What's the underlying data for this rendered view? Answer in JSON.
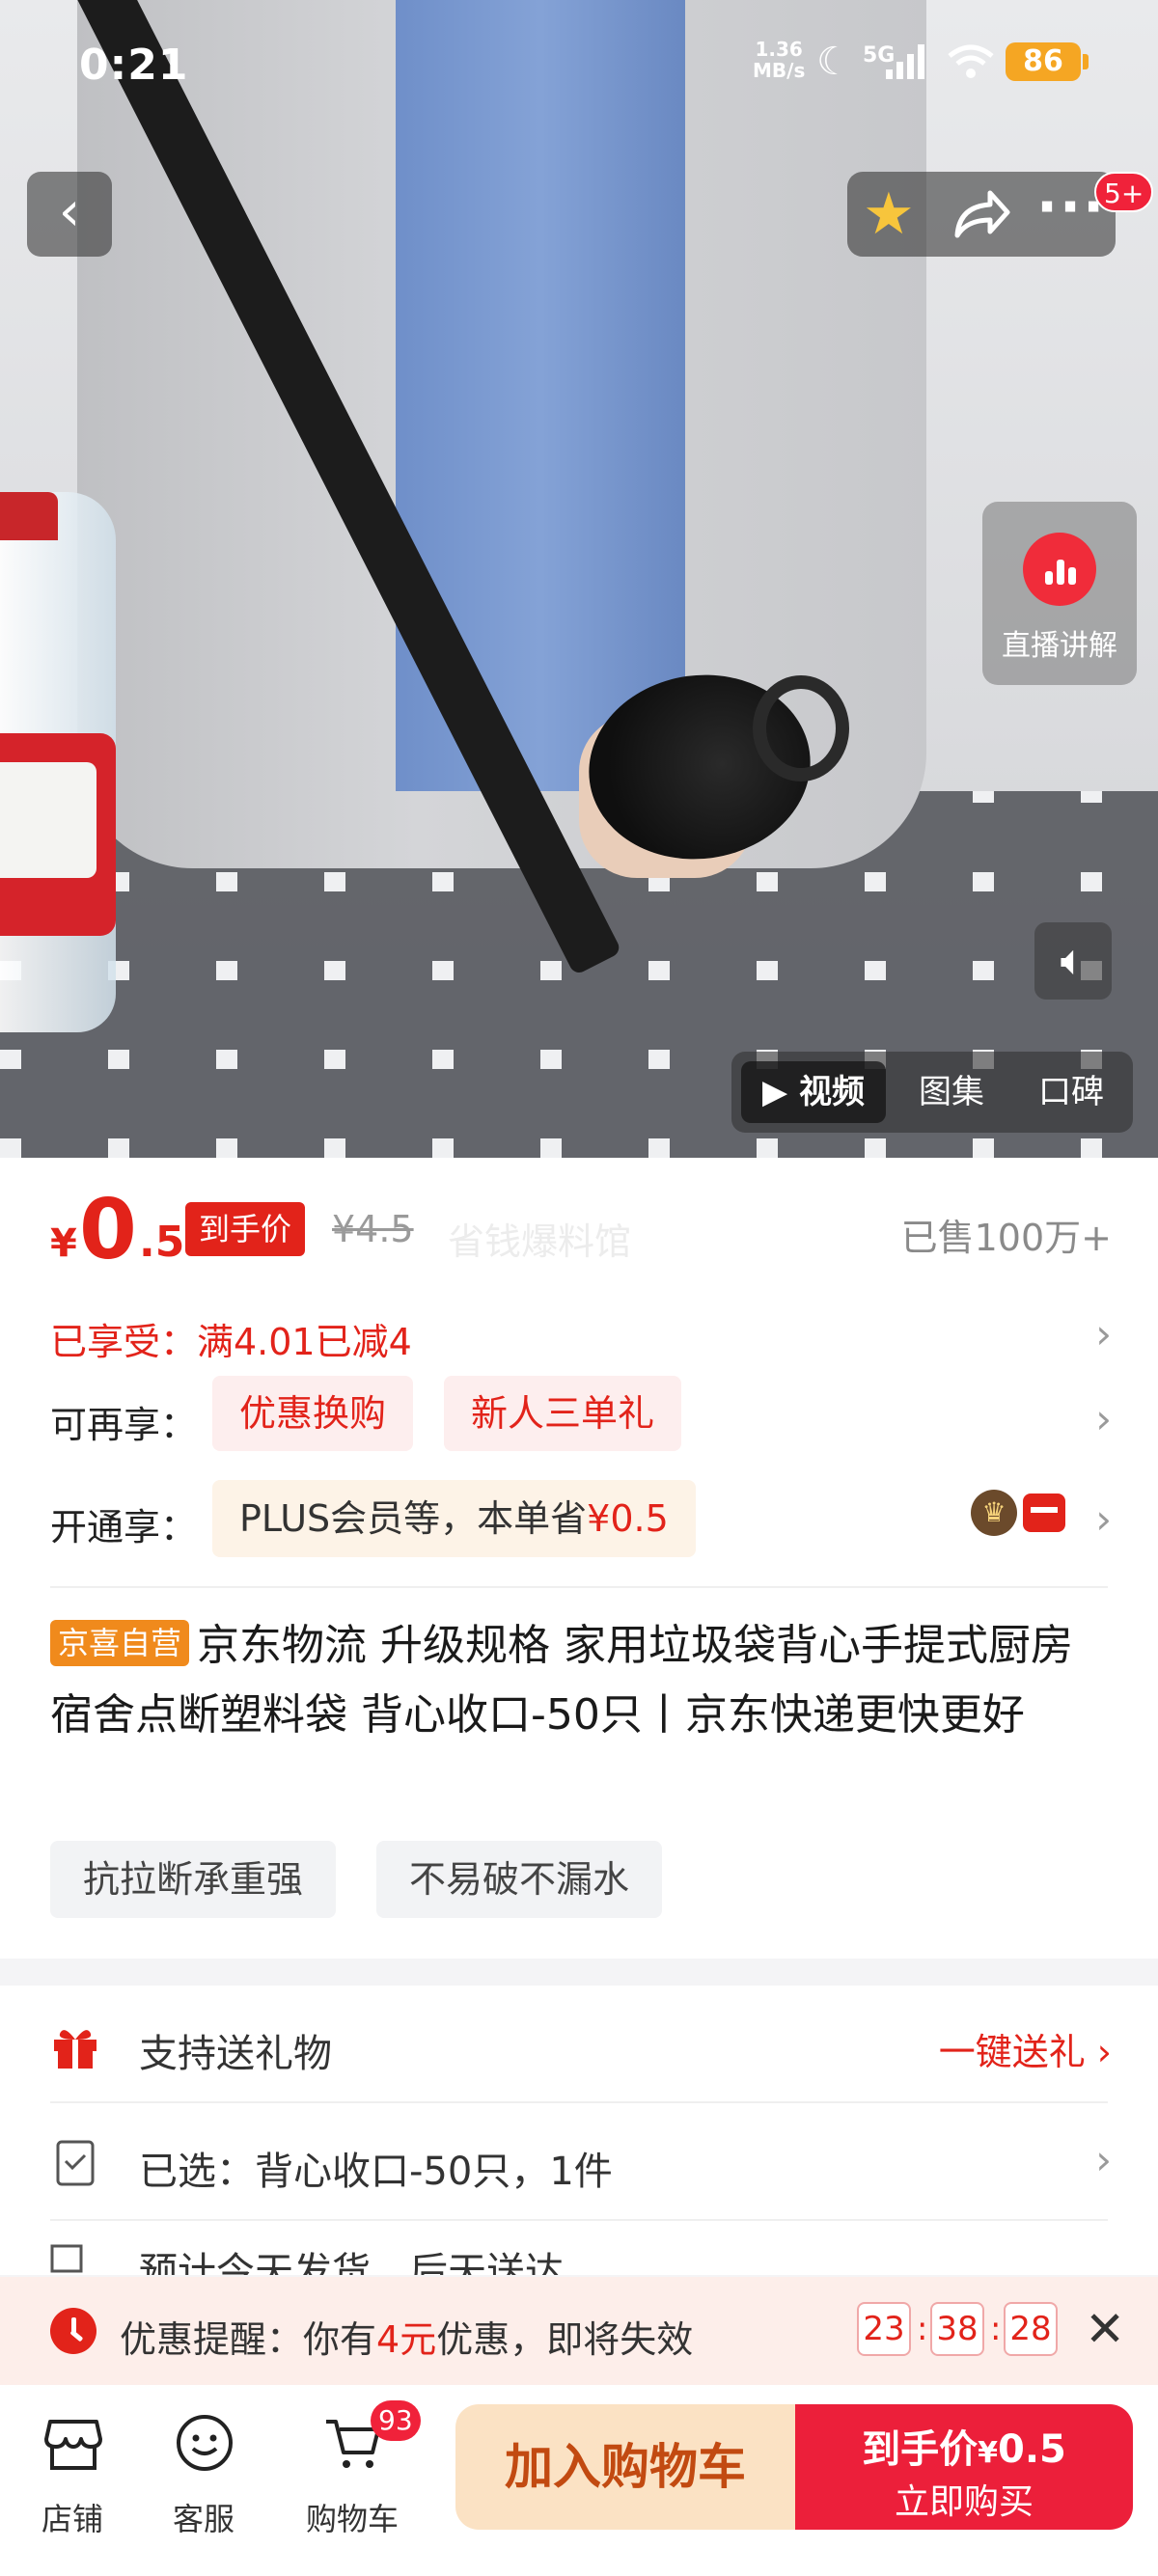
{
  "status_bar": {
    "time": "0:21",
    "net_speed_value": "1.36",
    "net_speed_unit": "MB/s",
    "network": "5G",
    "battery": "86"
  },
  "nav": {
    "back_icon": "chevron-left-icon",
    "favorite_icon": "star-icon",
    "share_icon": "share-icon",
    "more_icon": "more-dots-icon",
    "badge": "5+"
  },
  "media": {
    "live_label": "直播讲解",
    "tabs": [
      "▶ 视频",
      "图集",
      "口碑"
    ],
    "active_tab": 0
  },
  "price": {
    "currency": "¥",
    "integer": "0",
    "decimal": ".5",
    "final_tag": "到手价",
    "original": "¥4.5",
    "watermark": "省钱爆料馆",
    "sold": "已售100万+"
  },
  "promotions": {
    "enjoyed": "已享受：满4.01已减4",
    "more_label": "可再享：",
    "more_chips": [
      "优惠换购",
      "新人三单礼"
    ],
    "open_label": "开通享：",
    "plus_text": "PLUS会员等，本单省",
    "plus_amount": "¥0.5"
  },
  "product": {
    "badge": "京喜自营",
    "title": "京东物流 升级规格 家用垃圾袋背心手提式厨房宿舍点断塑料袋 背心收口-50只丨京东快递更快更好",
    "tags": [
      "抗拉断承重强",
      "不易破不漏水"
    ]
  },
  "service": {
    "gift_label": "支持送礼物",
    "gift_action": "一键送礼 ›",
    "selected_label": "已选：背心收口-50只，1件",
    "peek_label": "预计今天发货，后天送达"
  },
  "reminder": {
    "prefix": "优惠提醒：你有",
    "amount": "4元",
    "suffix": "优惠，即将失效",
    "hours": "23",
    "minutes": "38",
    "seconds": "28"
  },
  "bottom_bar": {
    "store": "店铺",
    "service": "客服",
    "cart": "购物车",
    "cart_count": "93",
    "add_to_cart": "加入购物车",
    "buy_top": "到手价",
    "buy_price_yen": "¥",
    "buy_price": "0.5",
    "buy_now": "立即购买"
  },
  "colors": {
    "accent_red": "#e2231a",
    "cta_red": "#ec1f3a",
    "cart_button_bg": "#fbe2c4",
    "brand_badge": "#f08a1c"
  }
}
